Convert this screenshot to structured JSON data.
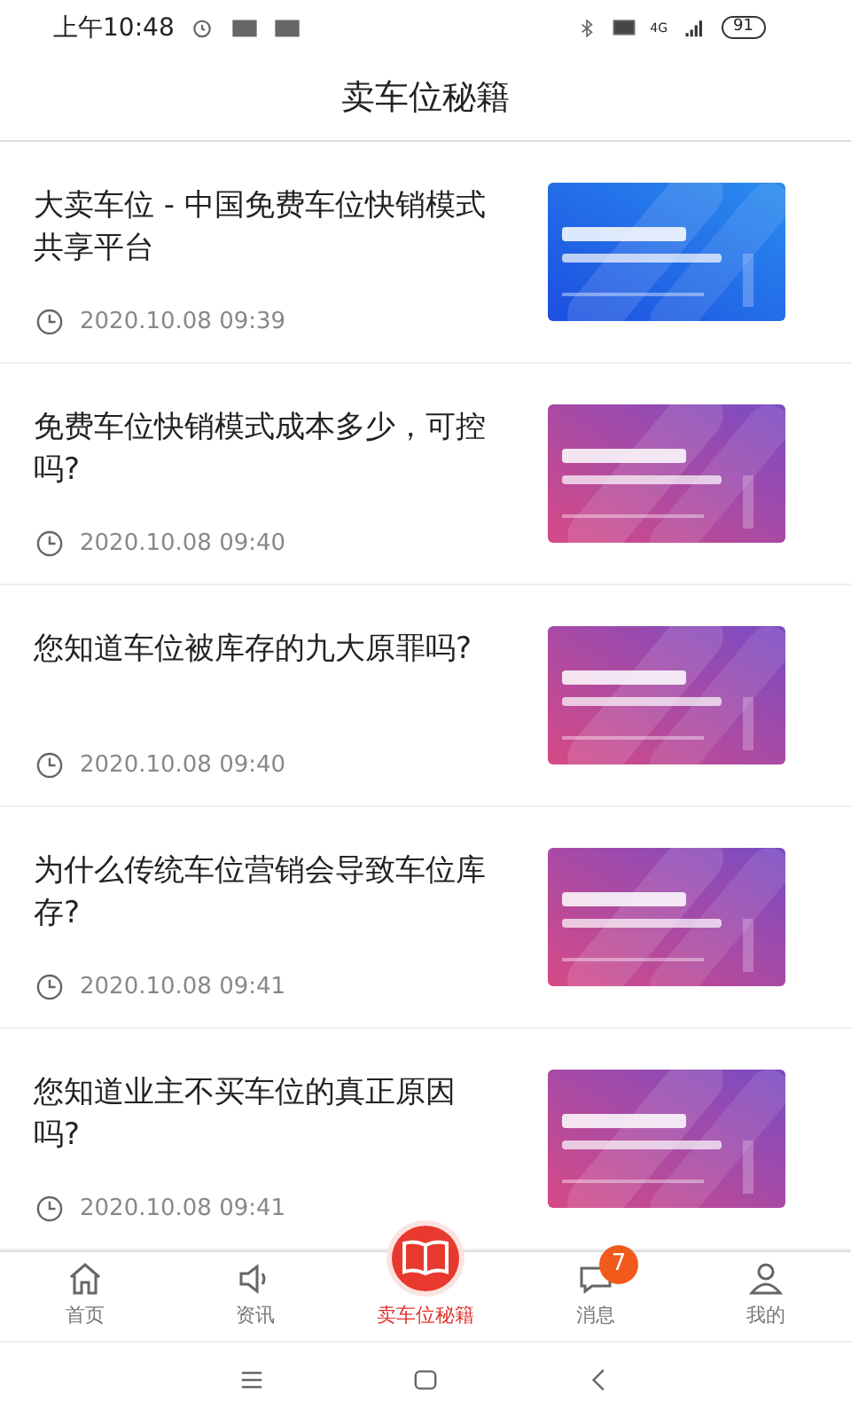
{
  "status_bar": {
    "time": "上午10:48",
    "network": "4G",
    "battery": "91"
  },
  "header": {
    "title": "卖车位秘籍"
  },
  "articles": [
    {
      "title": "大卖车位 - 中国免费车位快销模式共享平台",
      "time": "2020.10.08 09:39",
      "kind": "blue"
    },
    {
      "title": "免费车位快销模式成本多少，可控吗?",
      "time": "2020.10.08 09:40",
      "kind": "purple"
    },
    {
      "title": "您知道车位被库存的九大原罪吗?",
      "time": "2020.10.08 09:40",
      "kind": "purple"
    },
    {
      "title": "为什么传统车位营销会导致车位库存?",
      "time": "2020.10.08 09:41",
      "kind": "purple"
    },
    {
      "title": "您知道业主不买车位的真正原因吗?",
      "time": "2020.10.08 09:41",
      "kind": "purple"
    }
  ],
  "tab_bar": [
    {
      "label": "首页",
      "selected": false
    },
    {
      "label": "资讯",
      "selected": false
    },
    {
      "label": "卖车位秘籍",
      "selected": true
    },
    {
      "label": "消息",
      "selected": false,
      "badge": "7"
    },
    {
      "label": "我的",
      "selected": false
    }
  ]
}
